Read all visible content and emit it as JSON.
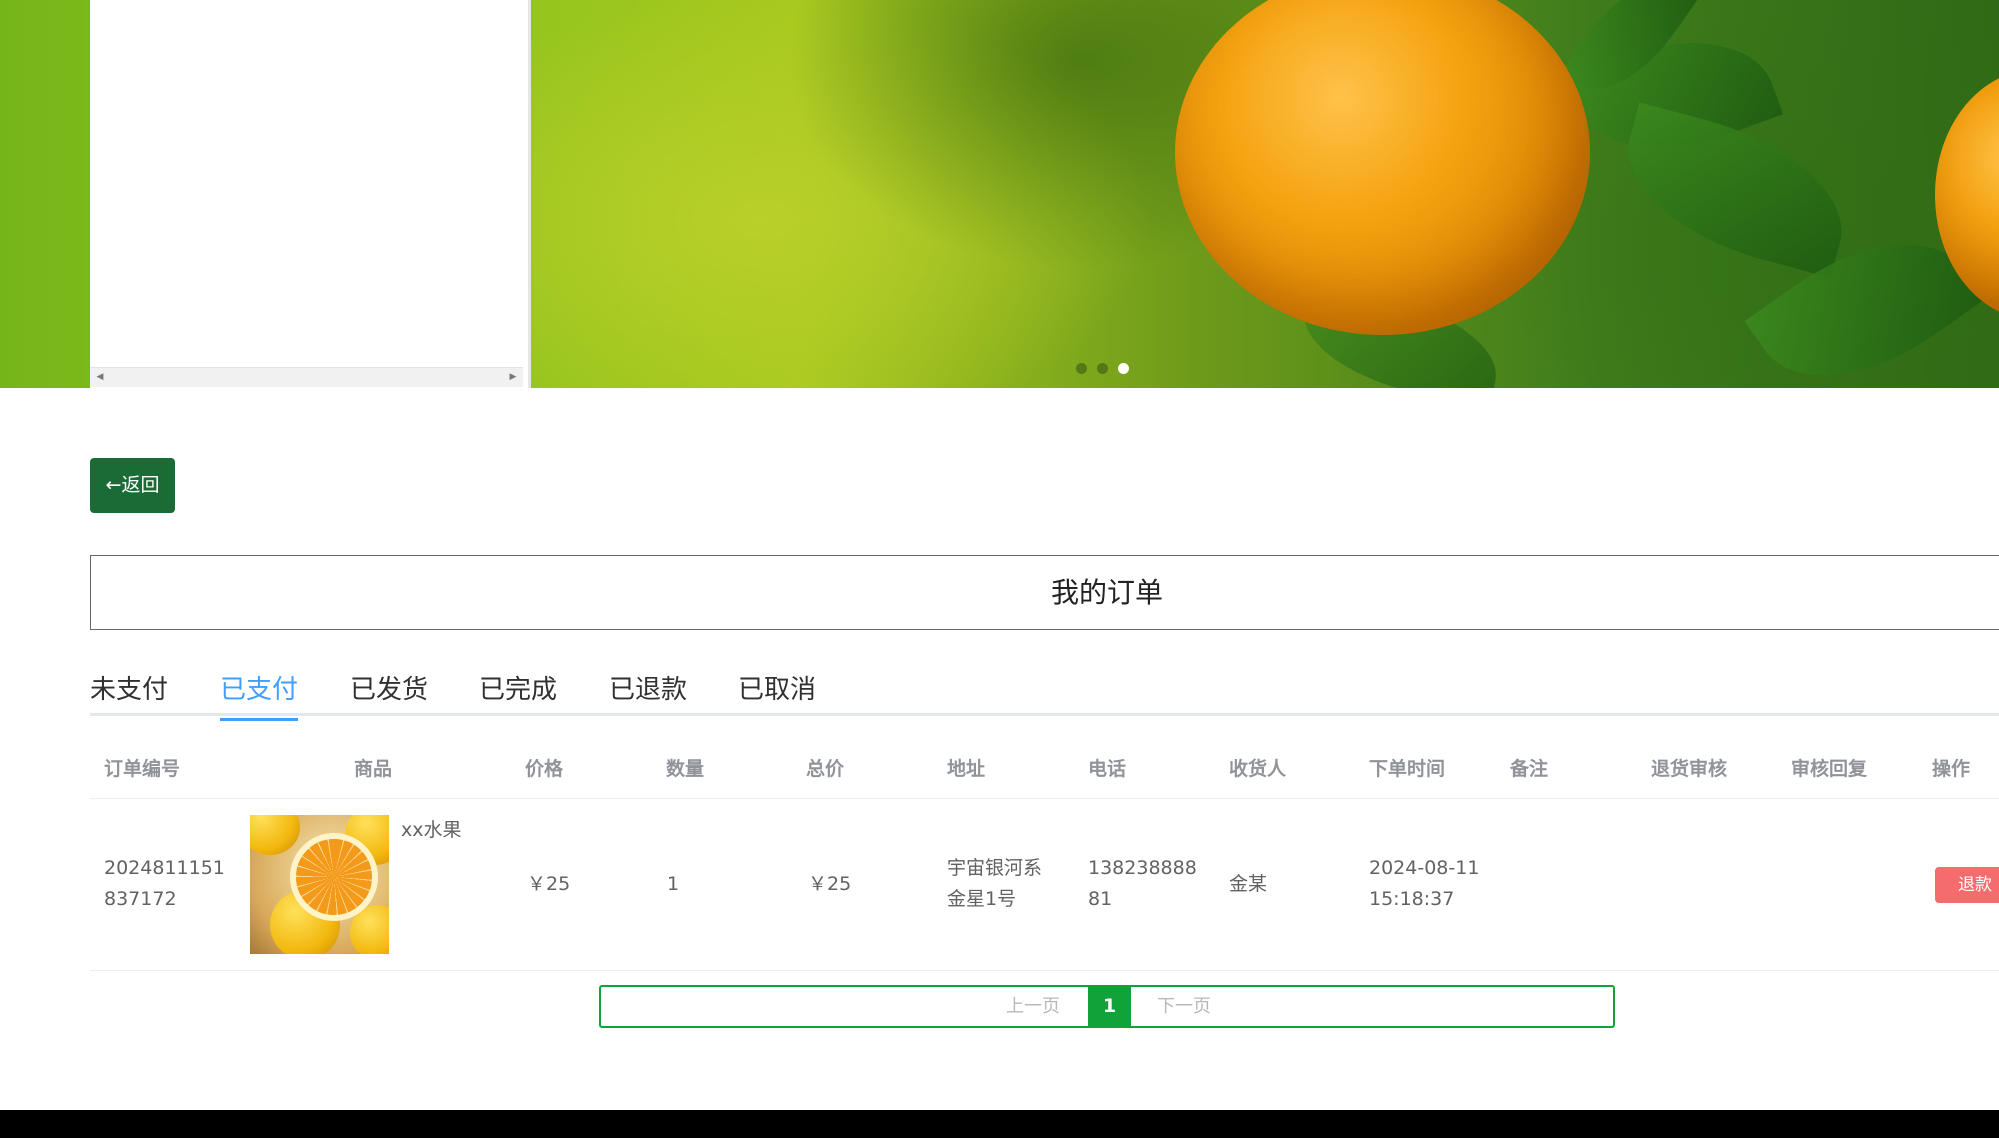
{
  "banner": {
    "slides_total": 3,
    "active_slide": 3
  },
  "back_button": {
    "label": "←返回"
  },
  "title": "我的订单",
  "tabs": [
    {
      "label": "未支付",
      "active": false
    },
    {
      "label": "已支付",
      "active": true
    },
    {
      "label": "已发货",
      "active": false
    },
    {
      "label": "已完成",
      "active": false
    },
    {
      "label": "已退款",
      "active": false
    },
    {
      "label": "已取消",
      "active": false
    }
  ],
  "table": {
    "headers": [
      "订单编号",
      "商品",
      "价格",
      "数量",
      "总价",
      "地址",
      "电话",
      "收货人",
      "下单时间",
      "备注",
      "退货审核",
      "审核回复",
      "操作"
    ],
    "rows": [
      {
        "order_no_line1": "2024811151",
        "order_no_line2": "837172",
        "product_name": "xx水果",
        "price": "￥25",
        "quantity": "1",
        "total": "￥25",
        "address_line1": "宇宙银河系",
        "address_line2": "金星1号",
        "phone_line1": "138238888",
        "phone_line2": "81",
        "receiver": "金某",
        "time_line1": "2024-08-11",
        "time_line2": "15:18:37",
        "remark": "",
        "return_review": "",
        "review_reply": "",
        "action_label": "退款"
      }
    ]
  },
  "pagination": {
    "prev": "上一页",
    "current": "1",
    "next": "下一页"
  },
  "colors": {
    "primary_green": "#1a6b35",
    "tab_active": "#409eff",
    "refund_red": "#f56c6c",
    "pager_green": "#11a33a"
  }
}
